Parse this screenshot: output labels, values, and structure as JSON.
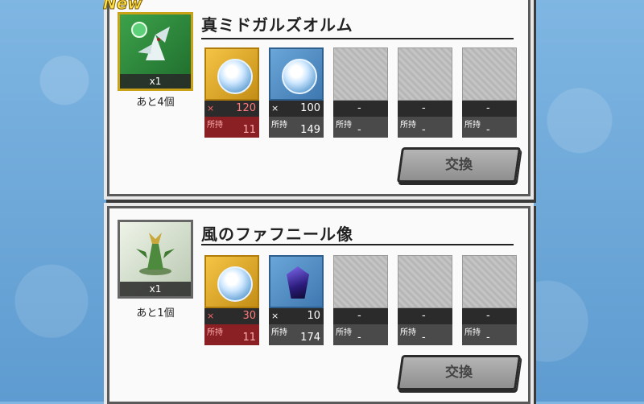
{
  "badge": {
    "new": "New"
  },
  "exchanges": [
    {
      "title": "真ミドガルズオルム",
      "reward_qty": "x1",
      "remaining": "あと4個",
      "exchange_label": "交換",
      "materials": [
        {
          "need_prefix": "×",
          "need": "120",
          "have_label": "所持",
          "have": "11"
        },
        {
          "need_prefix": "×",
          "need": "100",
          "have_label": "所持",
          "have": "149"
        },
        {
          "need_prefix": "",
          "need": "-",
          "have_label": "所持",
          "have": "-"
        },
        {
          "need_prefix": "",
          "need": "-",
          "have_label": "所持",
          "have": "-"
        },
        {
          "need_prefix": "",
          "need": "-",
          "have_label": "所持",
          "have": "-"
        }
      ]
    },
    {
      "title": "風のファフニール像",
      "reward_qty": "x1",
      "remaining": "あと1個",
      "exchange_label": "交換",
      "materials": [
        {
          "need_prefix": "×",
          "need": "30",
          "have_label": "所持",
          "have": "11"
        },
        {
          "need_prefix": "×",
          "need": "10",
          "have_label": "所持",
          "have": "174"
        },
        {
          "need_prefix": "",
          "need": "-",
          "have_label": "所持",
          "have": "-"
        },
        {
          "need_prefix": "",
          "need": "-",
          "have_label": "所持",
          "have": "-"
        },
        {
          "need_prefix": "",
          "need": "-",
          "have_label": "所持",
          "have": "-"
        }
      ]
    }
  ],
  "colors": {
    "shortage": "#8a1f24",
    "background": "#6fa8d8"
  }
}
